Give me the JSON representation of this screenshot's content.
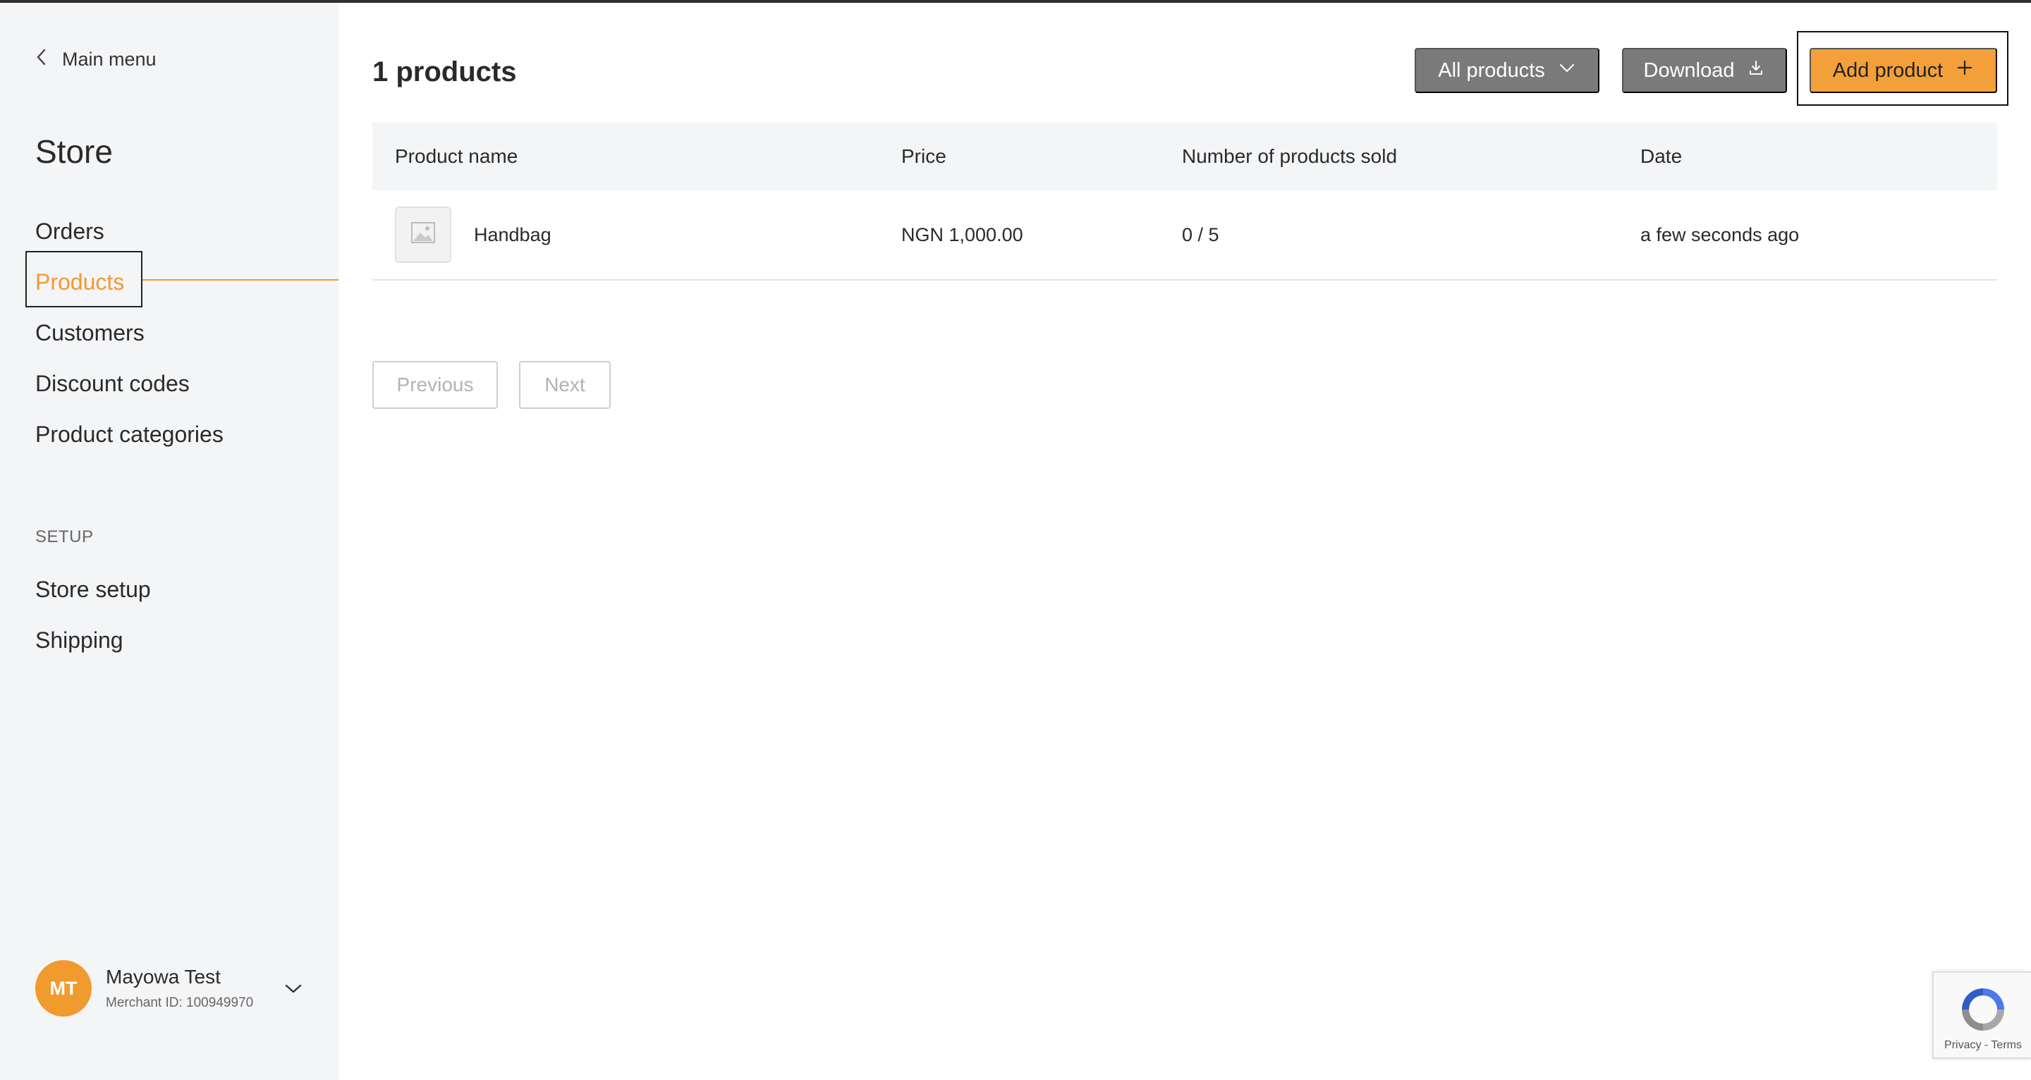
{
  "sidebar": {
    "back_label": "Main menu",
    "section_title": "Store",
    "items": [
      {
        "label": "Orders"
      },
      {
        "label": "Products"
      },
      {
        "label": "Customers"
      },
      {
        "label": "Discount codes"
      },
      {
        "label": "Product categories"
      }
    ],
    "active_item": "Products",
    "setup_label": "SETUP",
    "setup_items": [
      {
        "label": "Store setup"
      },
      {
        "label": "Shipping"
      }
    ],
    "user": {
      "initials": "MT",
      "name": "Mayowa Test",
      "merchant_id": "Merchant ID: 100949970"
    }
  },
  "header": {
    "title": "1 products",
    "filter_label": "All products",
    "download_label": "Download",
    "add_label": "Add product"
  },
  "table": {
    "columns": [
      "Product name",
      "Price",
      "Number of products sold",
      "Date"
    ],
    "rows": [
      {
        "name": "Handbag",
        "price": "NGN 1,000.00",
        "sold": "0 / 5",
        "date": "a few seconds ago"
      }
    ]
  },
  "pagination": {
    "previous_label": "Previous",
    "next_label": "Next"
  },
  "recaptcha": {
    "text": "Privacy - Terms"
  },
  "colors": {
    "accent": "#f19a2e",
    "button_gray": "#7a7a7a",
    "sidebar_bg": "#f4f5f7"
  },
  "icons": {
    "back": "chevron-left-icon",
    "filter": "chevron-down-icon",
    "download": "download-icon",
    "add": "plus-icon",
    "thumbnail": "image-placeholder-icon",
    "user_menu": "chevron-down-icon"
  }
}
